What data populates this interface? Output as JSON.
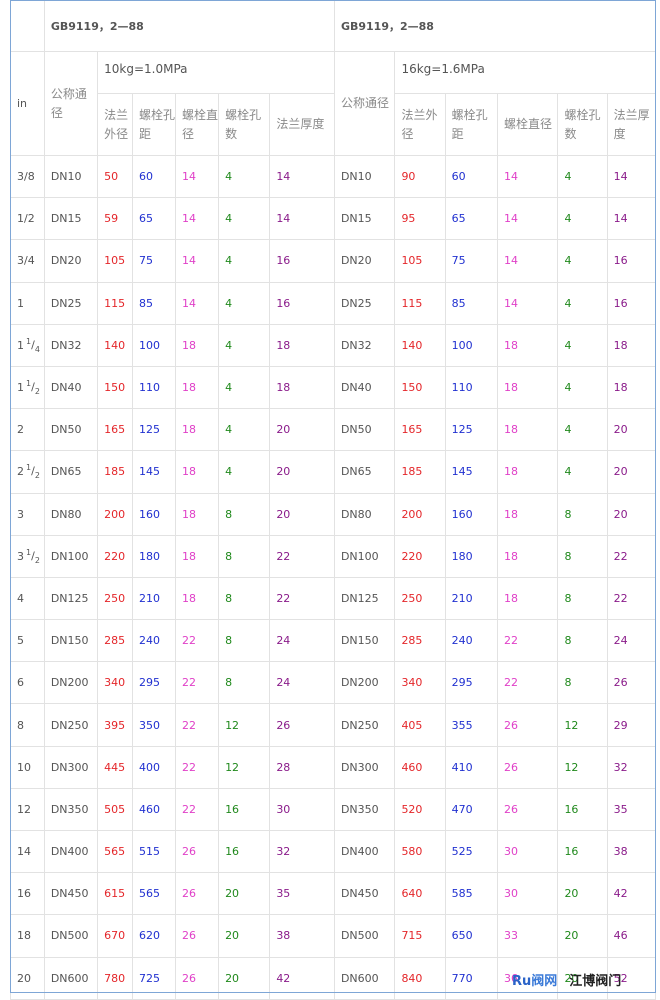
{
  "standard_left": "GB9119，2—88",
  "standard_right": "GB9119，2—88",
  "pressure_left": "10kg=1.0MPa",
  "pressure_right": "16kg=1.6MPa",
  "col_in": "in",
  "col_nominal": "公称通径",
  "col_flange_od": "法兰外径",
  "col_bolt_pitch": "螺栓孔距",
  "col_bolt_dia": "螺栓直径",
  "col_bolt_count": "螺栓孔数",
  "col_flange_thick": "法兰厚度",
  "rows": [
    {
      "in": "3/8",
      "dn": "DN10",
      "a": [
        "50",
        "60",
        "14",
        "4",
        "14"
      ],
      "b": [
        "90",
        "60",
        "14",
        "4",
        "14"
      ]
    },
    {
      "in": "1/2",
      "dn": "DN15",
      "a": [
        "59",
        "65",
        "14",
        "4",
        "14"
      ],
      "b": [
        "95",
        "65",
        "14",
        "4",
        "14"
      ]
    },
    {
      "in": "3/4",
      "dn": "DN20",
      "a": [
        "105",
        "75",
        "14",
        "4",
        "16"
      ],
      "b": [
        "105",
        "75",
        "14",
        "4",
        "16"
      ]
    },
    {
      "in": "1",
      "dn": "DN25",
      "a": [
        "115",
        "85",
        "14",
        "4",
        "16"
      ],
      "b": [
        "115",
        "85",
        "14",
        "4",
        "16"
      ]
    },
    {
      "in_whole": "1",
      "in_num": "1",
      "in_den": "4",
      "dn": "DN32",
      "a": [
        "140",
        "100",
        "18",
        "4",
        "18"
      ],
      "b": [
        "140",
        "100",
        "18",
        "4",
        "18"
      ]
    },
    {
      "in_whole": "1",
      "in_num": "1",
      "in_den": "2",
      "dn": "DN40",
      "a": [
        "150",
        "110",
        "18",
        "4",
        "18"
      ],
      "b": [
        "150",
        "110",
        "18",
        "4",
        "18"
      ]
    },
    {
      "in": "2",
      "dn": "DN50",
      "a": [
        "165",
        "125",
        "18",
        "4",
        "20"
      ],
      "b": [
        "165",
        "125",
        "18",
        "4",
        "20"
      ]
    },
    {
      "in_whole": "2",
      "in_num": "1",
      "in_den": "2",
      "dn": "DN65",
      "a": [
        "185",
        "145",
        "18",
        "4",
        "20"
      ],
      "b": [
        "185",
        "145",
        "18",
        "4",
        "20"
      ]
    },
    {
      "in": "3",
      "dn": "DN80",
      "a": [
        "200",
        "160",
        "18",
        "8",
        "20"
      ],
      "b": [
        "200",
        "160",
        "18",
        "8",
        "20"
      ]
    },
    {
      "in_whole": "3",
      "in_num": "1",
      "in_den": "2",
      "dn": "DN100",
      "a": [
        "220",
        "180",
        "18",
        "8",
        "22"
      ],
      "b": [
        "220",
        "180",
        "18",
        "8",
        "22"
      ]
    },
    {
      "in": "4",
      "dn": "DN125",
      "a": [
        "250",
        "210",
        "18",
        "8",
        "22"
      ],
      "b": [
        "250",
        "210",
        "18",
        "8",
        "22"
      ]
    },
    {
      "in": "5",
      "dn": "DN150",
      "a": [
        "285",
        "240",
        "22",
        "8",
        "24"
      ],
      "b": [
        "285",
        "240",
        "22",
        "8",
        "24"
      ]
    },
    {
      "in": "6",
      "dn": "DN200",
      "a": [
        "340",
        "295",
        "22",
        "8",
        "24"
      ],
      "b": [
        "340",
        "295",
        "22",
        "8",
        "26"
      ]
    },
    {
      "in": "8",
      "dn": "DN250",
      "a": [
        "395",
        "350",
        "22",
        "12",
        "26"
      ],
      "b": [
        "405",
        "355",
        "26",
        "12",
        "29"
      ]
    },
    {
      "in": "10",
      "dn": "DN300",
      "a": [
        "445",
        "400",
        "22",
        "12",
        "28"
      ],
      "b": [
        "460",
        "410",
        "26",
        "12",
        "32"
      ]
    },
    {
      "in": "12",
      "dn": "DN350",
      "a": [
        "505",
        "460",
        "22",
        "16",
        "30"
      ],
      "b": [
        "520",
        "470",
        "26",
        "16",
        "35"
      ]
    },
    {
      "in": "14",
      "dn": "DN400",
      "a": [
        "565",
        "515",
        "26",
        "16",
        "32"
      ],
      "b": [
        "580",
        "525",
        "30",
        "16",
        "38"
      ]
    },
    {
      "in": "16",
      "dn": "DN450",
      "a": [
        "615",
        "565",
        "26",
        "20",
        "35"
      ],
      "b": [
        "640",
        "585",
        "30",
        "20",
        "42"
      ]
    },
    {
      "in": "18",
      "dn": "DN500",
      "a": [
        "670",
        "620",
        "26",
        "20",
        "38"
      ],
      "b": [
        "715",
        "650",
        "33",
        "20",
        "46"
      ]
    },
    {
      "in": "20",
      "dn": "DN600",
      "a": [
        "780",
        "725",
        "26",
        "20",
        "42"
      ],
      "b": [
        "840",
        "770",
        "36",
        "20",
        "52"
      ]
    }
  ],
  "watermark_left": "Ru",
  "watermark_mid": "阀网",
  "watermark_right": "江博阀门"
}
